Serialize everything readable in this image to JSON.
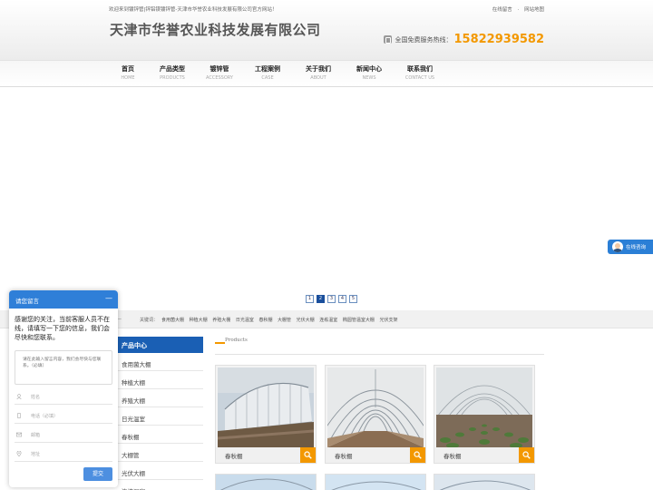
{
  "header": {
    "welcome": "欢迎来到镀锌管|锌铝镁镀锌管-天津市华誉农业科技发展有限公司官方网站！",
    "links": [
      "在线留言",
      "·",
      "网站地图"
    ],
    "company": "天津市华誉农业科技发展有限公司",
    "hotline_label": "全国免费服务热线：",
    "hotline_number": "15822939582"
  },
  "nav": [
    {
      "cn": "首页",
      "en": "HOME"
    },
    {
      "cn": "产品类型",
      "en": "PRODUCTS"
    },
    {
      "cn": "镀锌管",
      "en": "ACCESSORY"
    },
    {
      "cn": "工程案例",
      "en": "CASE"
    },
    {
      "cn": "关于我们",
      "en": "ABOUT"
    },
    {
      "cn": "新闻中心",
      "en": "NEWS"
    },
    {
      "cn": "联系我们",
      "en": "CONTACT US"
    }
  ],
  "banner_pager": {
    "pages": [
      "1",
      "2",
      "3",
      "4",
      "5"
    ],
    "active": 2
  },
  "keywords": {
    "lead": "—",
    "label": "关键词：",
    "items": [
      "食用菌大棚",
      "种植大棚",
      "养殖大棚",
      "日光温室",
      "春秋棚",
      "大棚管",
      "光伏大棚",
      "连栋温室",
      "椭圆管温室大棚",
      "光伏支架"
    ]
  },
  "sidebar": {
    "title": "产品中心",
    "items": [
      "食用菌大棚",
      "种植大棚",
      "养殖大棚",
      "日光温室",
      "春秋棚",
      "大棚管",
      "光伏大棚",
      "连栋温室"
    ]
  },
  "products": {
    "heading": "Products",
    "items": [
      {
        "label": "春秋棚"
      },
      {
        "label": "春秋棚"
      },
      {
        "label": "春秋棚"
      }
    ]
  },
  "chat_float": {
    "label": "在线咨询"
  },
  "message_form": {
    "title": "请您留言",
    "minimize": "—",
    "intro": "感谢您的关注，当前客服人员不在线，请填写一下您的信息，我们会尽快和您联系。",
    "textarea_placeholder": "请在此输入留言内容，我们会尽快与您联系。（必填）",
    "fields": [
      {
        "placeholder": "姓名",
        "icon": "person-icon"
      },
      {
        "placeholder": "电话（必填）",
        "icon": "phone-icon"
      },
      {
        "placeholder": "邮箱",
        "icon": "mail-icon"
      },
      {
        "placeholder": "地址",
        "icon": "location-icon"
      }
    ],
    "submit": "提交"
  },
  "colors": {
    "accent": "#f39800",
    "brand_blue": "#1a5fb4",
    "chat_blue": "#2f7fd8"
  }
}
